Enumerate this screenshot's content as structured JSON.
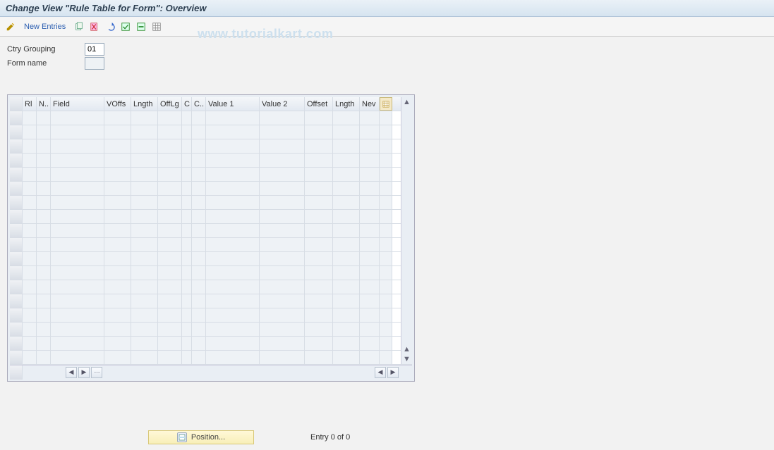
{
  "title": "Change View \"Rule Table for Form\": Overview",
  "watermark": "www.tutorialkart.com",
  "toolbar": {
    "new_entries": "New Entries"
  },
  "form": {
    "ctry_label": "Ctry Grouping",
    "ctry_value": "01",
    "formname_label": "Form name",
    "formname_value": ""
  },
  "columns": {
    "rl": "Rl",
    "n": "N..",
    "field": "Field",
    "voffs": "VOffs",
    "lngth": "Lngth",
    "offlg": "OffLg",
    "c1": "C",
    "c2": "C..",
    "val1": "Value 1",
    "val2": "Value 2",
    "offset": "Offset",
    "lngth2": "Lngth",
    "new": "Nev"
  },
  "footer": {
    "position": "Position...",
    "entry": "Entry 0 of 0"
  }
}
